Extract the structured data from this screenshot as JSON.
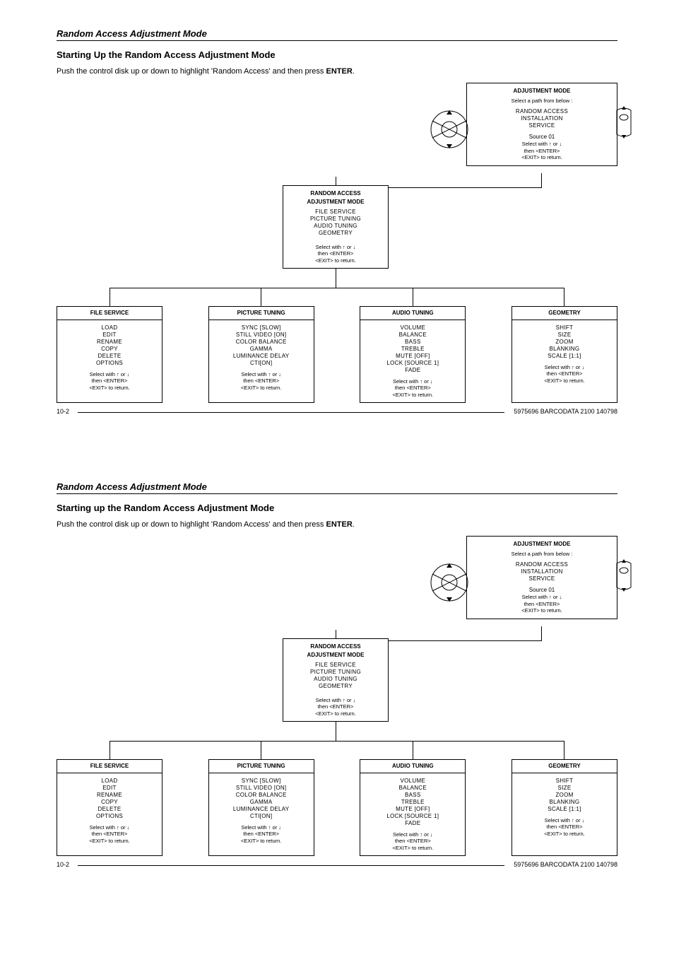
{
  "page_header": "Random Access Adjustment Mode",
  "section1_title": "Starting Up the Random Access Adjustment Mode",
  "section2_title": "Starting up the Random Access Adjustment Mode",
  "intro_prefix": "Push the control disk up or down to highlight 'Random Access' and then press ",
  "intro_enter": "ENTER",
  "intro_suffix": ".",
  "adjustment_mode": {
    "title": "ADJUSTMENT MODE",
    "subtitle": "Select a path from below :",
    "items_line1": "RANDOM ACCESS",
    "items_line2": "INSTALLATION",
    "items_line3": "SERVICE",
    "source": "Source 01",
    "hint1": "Select with ↑ or ↓",
    "hint2": "then <ENTER>",
    "hint3": "<EXIT> to return."
  },
  "random_access": {
    "title1": "RANDOM  ACCESS",
    "title2": "ADJUSTMENT MODE",
    "items_line1": "FILE SERVICE",
    "items_line2": "PICTURE TUNING",
    "items_line3": "AUDIO TUNING",
    "items_line4": "GEOMETRY",
    "hint1": "Select with ↑ or ↓",
    "hint2": "then <ENTER>",
    "hint3": "<EXIT> to return."
  },
  "file_service": {
    "title": "FILE  SERVICE",
    "l1": "LOAD",
    "l2": "EDIT",
    "l3": "RENAME",
    "l4": "COPY",
    "l5": "DELETE",
    "l6": "OPTIONS",
    "hint1": "Select with ↑ or ↓",
    "hint2": "then <ENTER>",
    "hint3": "<EXIT> to return."
  },
  "picture_tuning": {
    "title": "PICTURE  TUNING",
    "l1": "SYNC [SLOW]",
    "l2": "STILL VIDEO [ON]",
    "l3": "COLOR BALANCE",
    "l4": "GAMMA",
    "l5": "LUMINANCE DELAY",
    "l6": "CTI[ON]",
    "hint1": "Select with ↑ or ↓",
    "hint2": "then <ENTER>",
    "hint3": "<EXIT> to return."
  },
  "audio_tuning": {
    "title": "AUDIO TUNING",
    "l1": "VOLUME",
    "l2": "BALANCE",
    "l3": "BASS",
    "l4": "TREBLE",
    "l5": "MUTE [OFF]",
    "l6": "LOCK [SOURCE 1]",
    "l7": "FADE",
    "hint1": "Select with ↑ or ↓",
    "hint2": "then <ENTER>",
    "hint3": "<EXIT> to return."
  },
  "geometry": {
    "title": "GEOMETRY",
    "l1": "SHIFT",
    "l2": "SIZE",
    "l3": "ZOOM",
    "l4": "BLANKING",
    "l5": "SCALE [1:1]",
    "hint1": "Select with ↑ or ↓",
    "hint2": "then <ENTER>",
    "hint3": "<EXIT> to return."
  },
  "footer": {
    "page_num": "10-2",
    "code": "5975696 BARCODATA 2100 140798"
  }
}
